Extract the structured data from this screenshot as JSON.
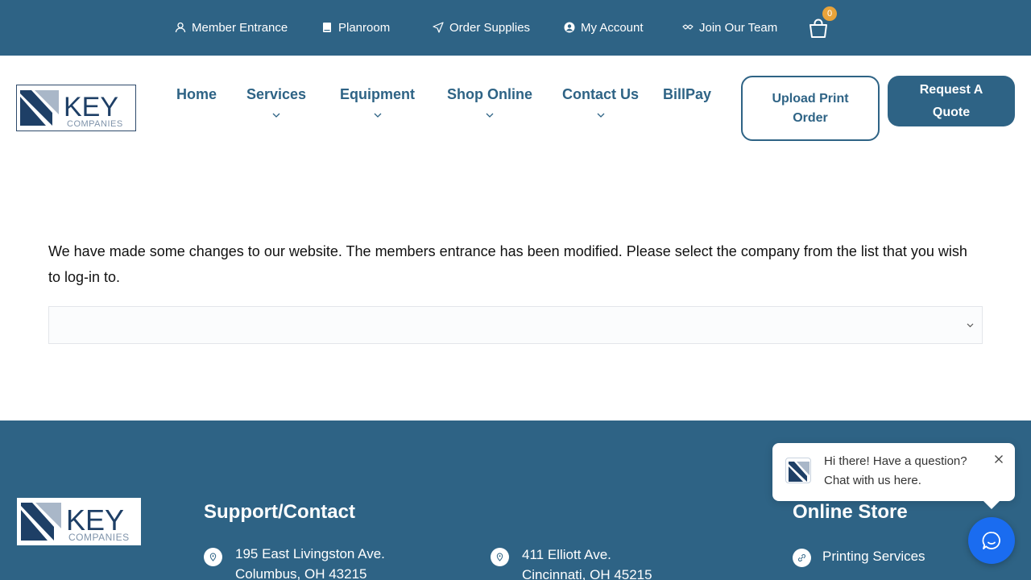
{
  "topbar": {
    "links": [
      {
        "label": "Member Entrance",
        "icon": "user-icon"
      },
      {
        "label": "Planroom",
        "icon": "book-icon"
      },
      {
        "label": "Order Supplies",
        "icon": "send-icon"
      },
      {
        "label": "My Account",
        "icon": "account-circle-icon"
      },
      {
        "label": "Join Our Team",
        "icon": "handshake-icon"
      }
    ],
    "cart_count": "0"
  },
  "logo": {
    "word": "KEY",
    "sub": "COMPANIES"
  },
  "nav": {
    "items": [
      {
        "label": "Home",
        "has_dropdown": false
      },
      {
        "label": "Services",
        "has_dropdown": true
      },
      {
        "label": "Equipment",
        "has_dropdown": true
      },
      {
        "label": "Shop Online",
        "has_dropdown": true
      },
      {
        "label": "Contact Us",
        "has_dropdown": true
      },
      {
        "label": "BillPay",
        "has_dropdown": false
      }
    ],
    "upload_label": "Upload Print Order",
    "quote_label": "Request A Quote"
  },
  "main": {
    "notice": "We have made some changes to our website. The members entrance has been modified. Please select the company from the list that you wish to log-in to.",
    "select_value": ""
  },
  "footer": {
    "support_heading": "Support/Contact",
    "address1": {
      "line1": "195 East Livingston Ave.",
      "line2": "Columbus, OH 43215"
    },
    "address2": {
      "line1": "411 Elliott Ave.",
      "line2": "Cincinnati, OH 45215"
    },
    "store_heading": "Online Store",
    "store_links": [
      "Printing Services"
    ]
  },
  "chat": {
    "line1": "Hi there! Have a question?",
    "line2": "Chat with us here."
  },
  "colors": {
    "brand": "#2e6385",
    "badge": "#e8a33a",
    "chat": "#1a6cf0"
  }
}
